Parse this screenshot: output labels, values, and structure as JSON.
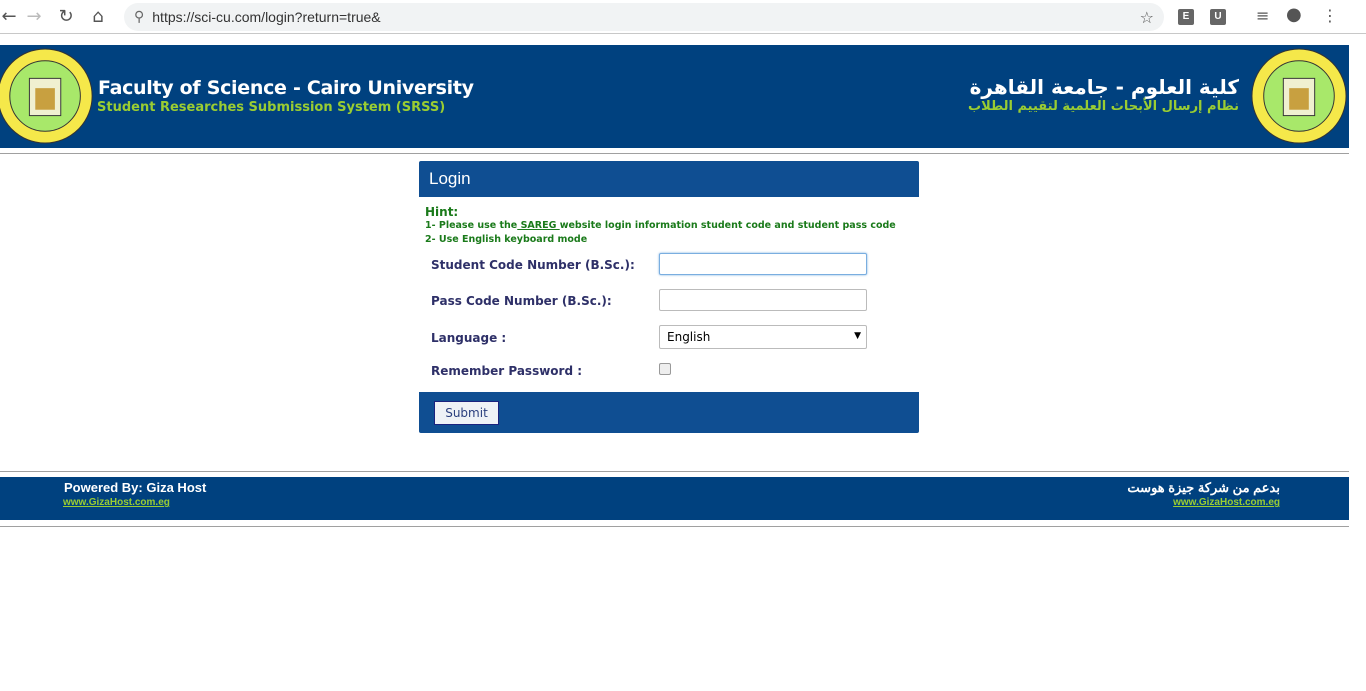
{
  "browser": {
    "url": "https://sci-cu.com/login?return=true&",
    "extensions": [
      "E",
      "U"
    ]
  },
  "header": {
    "title": "Faculty of Science - Cairo University",
    "subtitle": "Student Researches Submission System (SRSS)",
    "title_ar": "كلية العلوم - جامعة القاهرة",
    "subtitle_ar": "نظام إرسال الأبحاث العلمية لتقييم الطلاب",
    "logo_text": "Faculty of Science - Cairo University"
  },
  "login": {
    "title": "Login",
    "hint_label": "Hint:",
    "hint1_pre": "1- Please use the",
    "hint1_link": " SAREG ",
    "hint1_post": "website login information student code and student pass code",
    "hint2": "2- Use English keyboard mode",
    "student_code_label": "Student Code Number (B.Sc.):",
    "student_code_value": "",
    "pass_code_label": "Pass Code Number (B.Sc.):",
    "pass_code_value": "",
    "language_label": "Language :",
    "language_value": "English",
    "remember_label": "Remember Password :",
    "remember_checked": false,
    "submit_label": "Submit"
  },
  "footer": {
    "powered_label": "Powered By: ",
    "powered_link": "Giza Host",
    "site": "www.GizaHost.com.eg",
    "powered_ar_label": "بدعم من شركة ",
    "powered_ar_link": "جيزة هوست",
    "site_ar": "www.GizaHost.com.eg"
  },
  "colors": {
    "header_bg": "#00417f",
    "panel_bg": "#0f4e92",
    "accent_green": "#9acd32",
    "hint_green": "#1a7a1a",
    "label_color": "#2e3068"
  }
}
